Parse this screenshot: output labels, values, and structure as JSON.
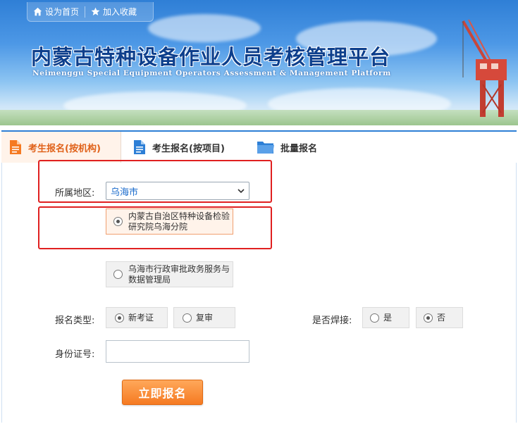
{
  "header": {
    "links": [
      {
        "label": "设为首页",
        "icon": "home-icon"
      },
      {
        "label": "加入收藏",
        "icon": "star-icon"
      }
    ],
    "title_cn": "内蒙古特种设备作业人员考核管理平台",
    "title_en": "Neimenggu Special Equipment Operators Assessment & Management Platform"
  },
  "tabs": [
    {
      "label": "考生报名(按机构)",
      "icon": "document-icon",
      "active": true
    },
    {
      "label": "考生报名(按项目)",
      "icon": "document-icon",
      "active": false
    },
    {
      "label": "批量报名",
      "icon": "folder-icon",
      "active": false
    }
  ],
  "form": {
    "region_label": "所属地区:",
    "region_value": "乌海市",
    "institutions": [
      {
        "line1": "内蒙古自治区特种设备检验",
        "line2": "研究院乌海分院",
        "selected": true
      },
      {
        "line1": "乌海市行政审批政务服务与",
        "line2": "数据管理局",
        "selected": false
      }
    ],
    "type_label": "报名类型:",
    "type_options": [
      {
        "label": "新考证",
        "selected": true
      },
      {
        "label": "复审",
        "selected": false
      }
    ],
    "weld_label": "是否焊接:",
    "weld_options": [
      {
        "label": "是",
        "selected": false
      },
      {
        "label": "否",
        "selected": true
      }
    ],
    "id_label": "身份证号:",
    "id_value": "",
    "submit_label": "立即报名"
  },
  "colors": {
    "accent_orange": "#f57a22",
    "tab_active_text": "#e0621a",
    "title_blue": "#0d3f8c",
    "highlight_red": "#e02020",
    "tab_icon_blue": "#2d7fd6"
  }
}
